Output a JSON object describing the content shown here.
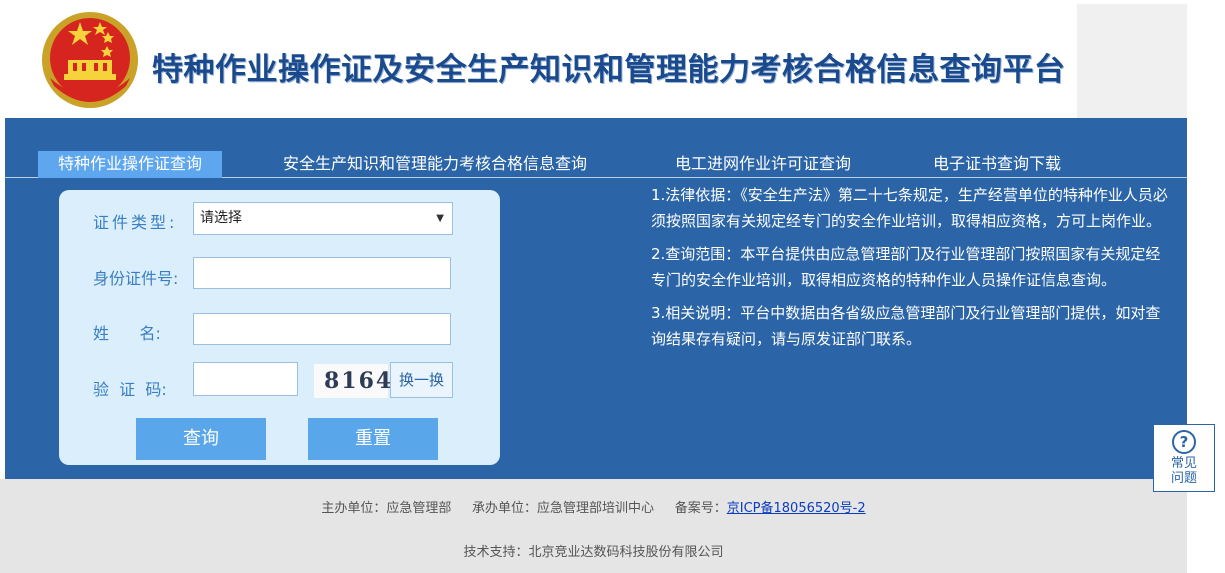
{
  "header": {
    "title": "特种作业操作证及安全生产知识和管理能力考核合格信息查询平台"
  },
  "nav": {
    "tabs": [
      {
        "label": "特种作业操作证查询"
      },
      {
        "label": "安全生产知识和管理能力考核合格信息查询"
      },
      {
        "label": "电工进网作业许可证查询"
      },
      {
        "label": "电子证书查询下载"
      }
    ]
  },
  "form": {
    "cert_type_label": "证件类型:",
    "cert_type_value": "请选择",
    "id_label": "身份证件号:",
    "id_value": "",
    "name_label": "姓      名:",
    "name_value": "",
    "captcha_label": "验  证  码:",
    "captcha_value": "",
    "captcha_text": "8164",
    "swap_label": "换一换",
    "query_label": "查询",
    "reset_label": "重置"
  },
  "info": {
    "items": [
      "1.法律依据：《安全生产法》第二十七条规定，生产经营单位的特种作业人员必须按照国家有关规定经专门的安全作业培训，取得相应资格，方可上岗作业。",
      "2.查询范围：本平台提供由应急管理部门及行业管理部门按照国家有关规定经专门的安全作业培训，取得相应资格的特种作业人员操作证信息查询。",
      "3.相关说明：平台中数据由各省级应急管理部门及行业管理部门提供，如对查询结果存有疑问，请与原发证部门联系。"
    ]
  },
  "footer": {
    "host": "主办单位：应急管理部",
    "organizer": "承办单位：应急管理部培训中心",
    "record_prefix": "备案号：",
    "record_link": "京ICP备18056520号-2",
    "support": "技术支持：北京竞业达数码科技股份有限公司"
  },
  "help": {
    "icon_char": "?",
    "label": "常见问题"
  },
  "colors": {
    "primary_blue": "#2b65a7",
    "tab_active": "#5ea6ee",
    "button_blue": "#5aa6ea",
    "panel_bg": "#dbeefb",
    "title_blue": "#1b4a8c"
  }
}
